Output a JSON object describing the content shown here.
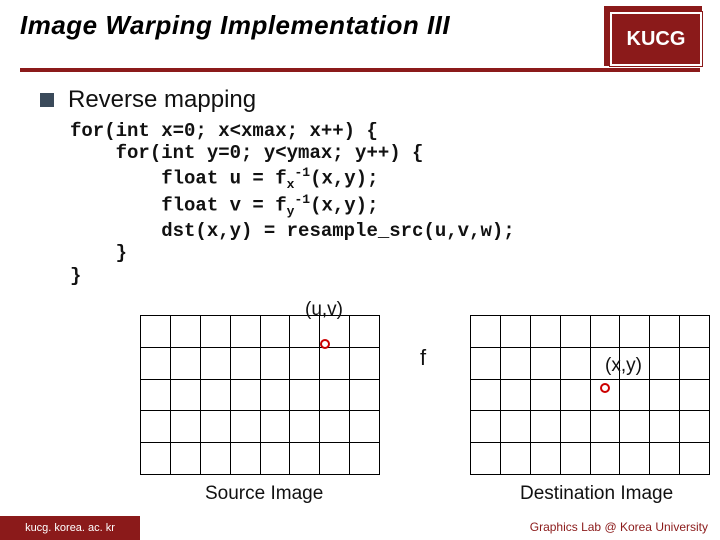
{
  "header": {
    "title": "Image Warping Implementation III",
    "badge": "KUCG"
  },
  "section_title": "Reverse mapping",
  "code": {
    "l1": "for(int x=0; x<xmax; x++) {",
    "l2": "    for(int y=0; y<ymax; y++) {",
    "l3a": "        float u = f",
    "l3sub": "x",
    "l3sup": "-1",
    "l3b": "(x,y);",
    "l4a": "        float v = f",
    "l4sub": "y",
    "l4sup": "-1",
    "l4b": "(x,y);",
    "l5": "        dst(x,y) = resample_src(u,v,w);",
    "l6": "    }",
    "l7": "}"
  },
  "figure": {
    "uv": "(u,v)",
    "xy": "(x,y)",
    "f": "f",
    "src_caption": "Source Image",
    "dst_caption": "Destination Image"
  },
  "footer": {
    "left": "kucg. korea. ac. kr",
    "right": "Graphics Lab @ Korea University"
  }
}
